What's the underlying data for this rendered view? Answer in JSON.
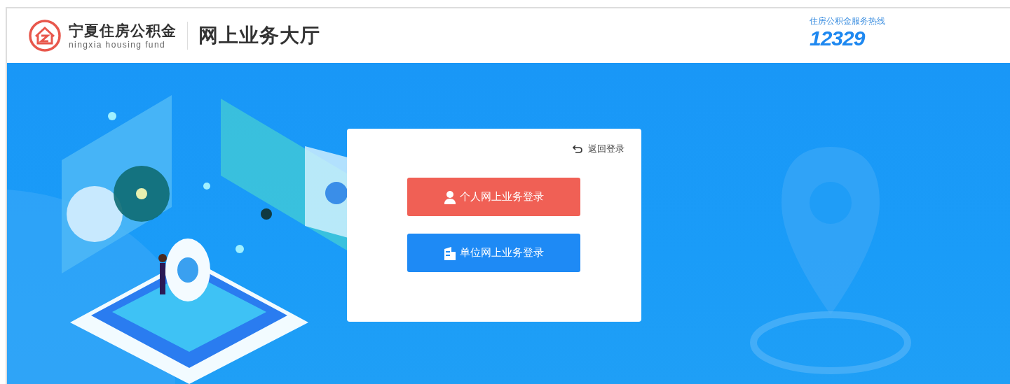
{
  "header": {
    "logo_title": "宁夏住房公积金",
    "logo_subtitle": "ningxia housing fund",
    "site_title": "网上业务大厅",
    "hotline_label": "住房公积金服务热线",
    "hotline_number": "12329"
  },
  "login_card": {
    "back_link": "返回登录",
    "buttons": [
      {
        "label": "个人网上业务登录",
        "kind": "person",
        "color": "#f06055"
      },
      {
        "label": "单位网上业务登录",
        "kind": "company",
        "color": "#1e8af5"
      }
    ]
  }
}
